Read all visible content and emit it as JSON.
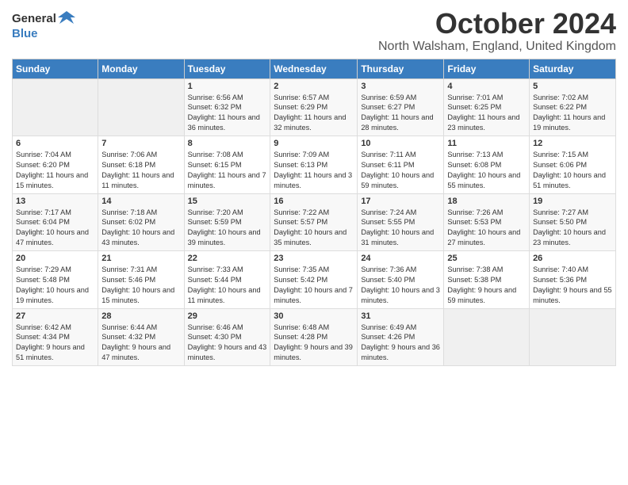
{
  "header": {
    "logo_general": "General",
    "logo_blue": "Blue",
    "month_title": "October 2024",
    "subtitle": "North Walsham, England, United Kingdom"
  },
  "days_of_week": [
    "Sunday",
    "Monday",
    "Tuesday",
    "Wednesday",
    "Thursday",
    "Friday",
    "Saturday"
  ],
  "weeks": [
    [
      {
        "day": "",
        "content": ""
      },
      {
        "day": "",
        "content": ""
      },
      {
        "day": "1",
        "content": "Sunrise: 6:56 AM\nSunset: 6:32 PM\nDaylight: 11 hours and 36 minutes."
      },
      {
        "day": "2",
        "content": "Sunrise: 6:57 AM\nSunset: 6:29 PM\nDaylight: 11 hours and 32 minutes."
      },
      {
        "day": "3",
        "content": "Sunrise: 6:59 AM\nSunset: 6:27 PM\nDaylight: 11 hours and 28 minutes."
      },
      {
        "day": "4",
        "content": "Sunrise: 7:01 AM\nSunset: 6:25 PM\nDaylight: 11 hours and 23 minutes."
      },
      {
        "day": "5",
        "content": "Sunrise: 7:02 AM\nSunset: 6:22 PM\nDaylight: 11 hours and 19 minutes."
      }
    ],
    [
      {
        "day": "6",
        "content": "Sunrise: 7:04 AM\nSunset: 6:20 PM\nDaylight: 11 hours and 15 minutes."
      },
      {
        "day": "7",
        "content": "Sunrise: 7:06 AM\nSunset: 6:18 PM\nDaylight: 11 hours and 11 minutes."
      },
      {
        "day": "8",
        "content": "Sunrise: 7:08 AM\nSunset: 6:15 PM\nDaylight: 11 hours and 7 minutes."
      },
      {
        "day": "9",
        "content": "Sunrise: 7:09 AM\nSunset: 6:13 PM\nDaylight: 11 hours and 3 minutes."
      },
      {
        "day": "10",
        "content": "Sunrise: 7:11 AM\nSunset: 6:11 PM\nDaylight: 10 hours and 59 minutes."
      },
      {
        "day": "11",
        "content": "Sunrise: 7:13 AM\nSunset: 6:08 PM\nDaylight: 10 hours and 55 minutes."
      },
      {
        "day": "12",
        "content": "Sunrise: 7:15 AM\nSunset: 6:06 PM\nDaylight: 10 hours and 51 minutes."
      }
    ],
    [
      {
        "day": "13",
        "content": "Sunrise: 7:17 AM\nSunset: 6:04 PM\nDaylight: 10 hours and 47 minutes."
      },
      {
        "day": "14",
        "content": "Sunrise: 7:18 AM\nSunset: 6:02 PM\nDaylight: 10 hours and 43 minutes."
      },
      {
        "day": "15",
        "content": "Sunrise: 7:20 AM\nSunset: 5:59 PM\nDaylight: 10 hours and 39 minutes."
      },
      {
        "day": "16",
        "content": "Sunrise: 7:22 AM\nSunset: 5:57 PM\nDaylight: 10 hours and 35 minutes."
      },
      {
        "day": "17",
        "content": "Sunrise: 7:24 AM\nSunset: 5:55 PM\nDaylight: 10 hours and 31 minutes."
      },
      {
        "day": "18",
        "content": "Sunrise: 7:26 AM\nSunset: 5:53 PM\nDaylight: 10 hours and 27 minutes."
      },
      {
        "day": "19",
        "content": "Sunrise: 7:27 AM\nSunset: 5:50 PM\nDaylight: 10 hours and 23 minutes."
      }
    ],
    [
      {
        "day": "20",
        "content": "Sunrise: 7:29 AM\nSunset: 5:48 PM\nDaylight: 10 hours and 19 minutes."
      },
      {
        "day": "21",
        "content": "Sunrise: 7:31 AM\nSunset: 5:46 PM\nDaylight: 10 hours and 15 minutes."
      },
      {
        "day": "22",
        "content": "Sunrise: 7:33 AM\nSunset: 5:44 PM\nDaylight: 10 hours and 11 minutes."
      },
      {
        "day": "23",
        "content": "Sunrise: 7:35 AM\nSunset: 5:42 PM\nDaylight: 10 hours and 7 minutes."
      },
      {
        "day": "24",
        "content": "Sunrise: 7:36 AM\nSunset: 5:40 PM\nDaylight: 10 hours and 3 minutes."
      },
      {
        "day": "25",
        "content": "Sunrise: 7:38 AM\nSunset: 5:38 PM\nDaylight: 9 hours and 59 minutes."
      },
      {
        "day": "26",
        "content": "Sunrise: 7:40 AM\nSunset: 5:36 PM\nDaylight: 9 hours and 55 minutes."
      }
    ],
    [
      {
        "day": "27",
        "content": "Sunrise: 6:42 AM\nSunset: 4:34 PM\nDaylight: 9 hours and 51 minutes."
      },
      {
        "day": "28",
        "content": "Sunrise: 6:44 AM\nSunset: 4:32 PM\nDaylight: 9 hours and 47 minutes."
      },
      {
        "day": "29",
        "content": "Sunrise: 6:46 AM\nSunset: 4:30 PM\nDaylight: 9 hours and 43 minutes."
      },
      {
        "day": "30",
        "content": "Sunrise: 6:48 AM\nSunset: 4:28 PM\nDaylight: 9 hours and 39 minutes."
      },
      {
        "day": "31",
        "content": "Sunrise: 6:49 AM\nSunset: 4:26 PM\nDaylight: 9 hours and 36 minutes."
      },
      {
        "day": "",
        "content": ""
      },
      {
        "day": "",
        "content": ""
      }
    ]
  ]
}
